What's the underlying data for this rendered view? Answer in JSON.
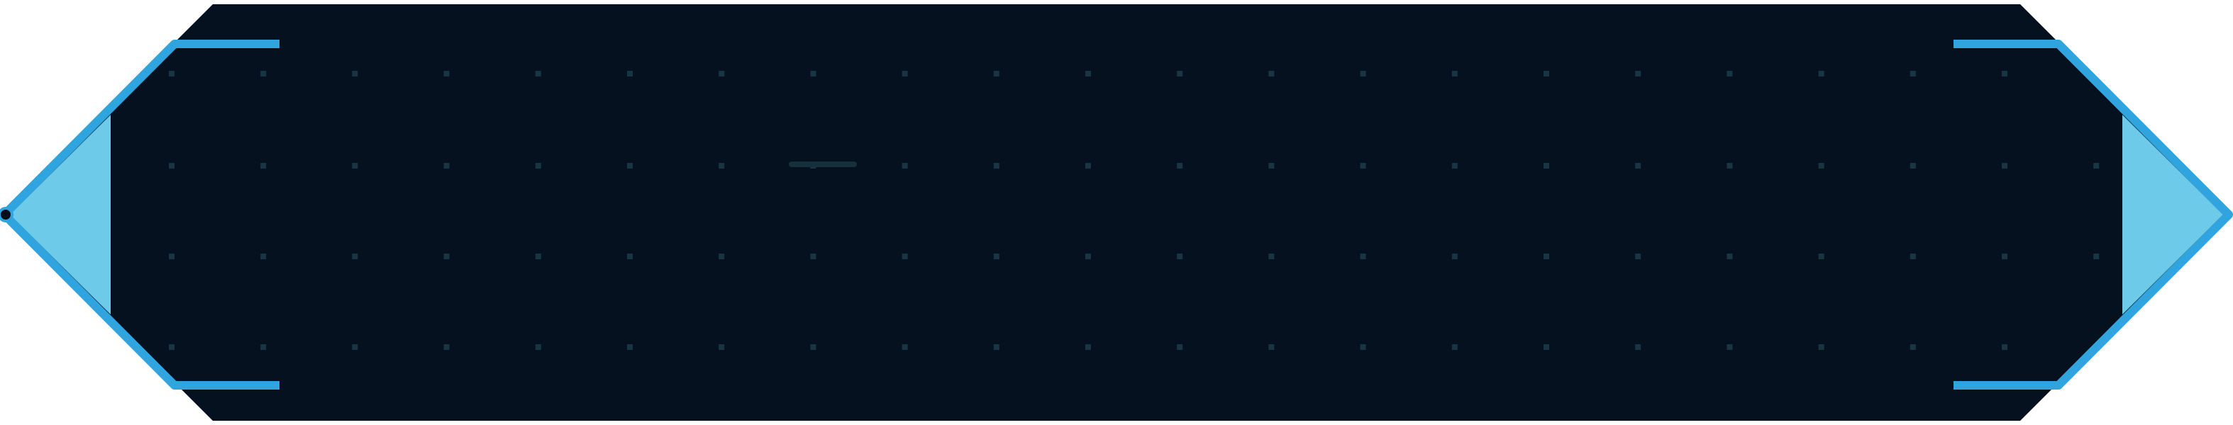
{
  "banner": {
    "colors": {
      "background": "#ffffff",
      "panel_fill": "#061120",
      "panel_fill_dark": "#030c18",
      "frame_stroke": "#2fa4df",
      "cap_fill": "#6dcae9",
      "grid_dot": "#173543",
      "faint_streak": "#15303c"
    },
    "shape": "elongated-hexagon",
    "pattern": "dot-grid",
    "end_caps": [
      "left-arrow",
      "right-arrow"
    ],
    "corner_brackets": [
      "top-left",
      "bottom-left",
      "top-right",
      "bottom-right"
    ]
  }
}
